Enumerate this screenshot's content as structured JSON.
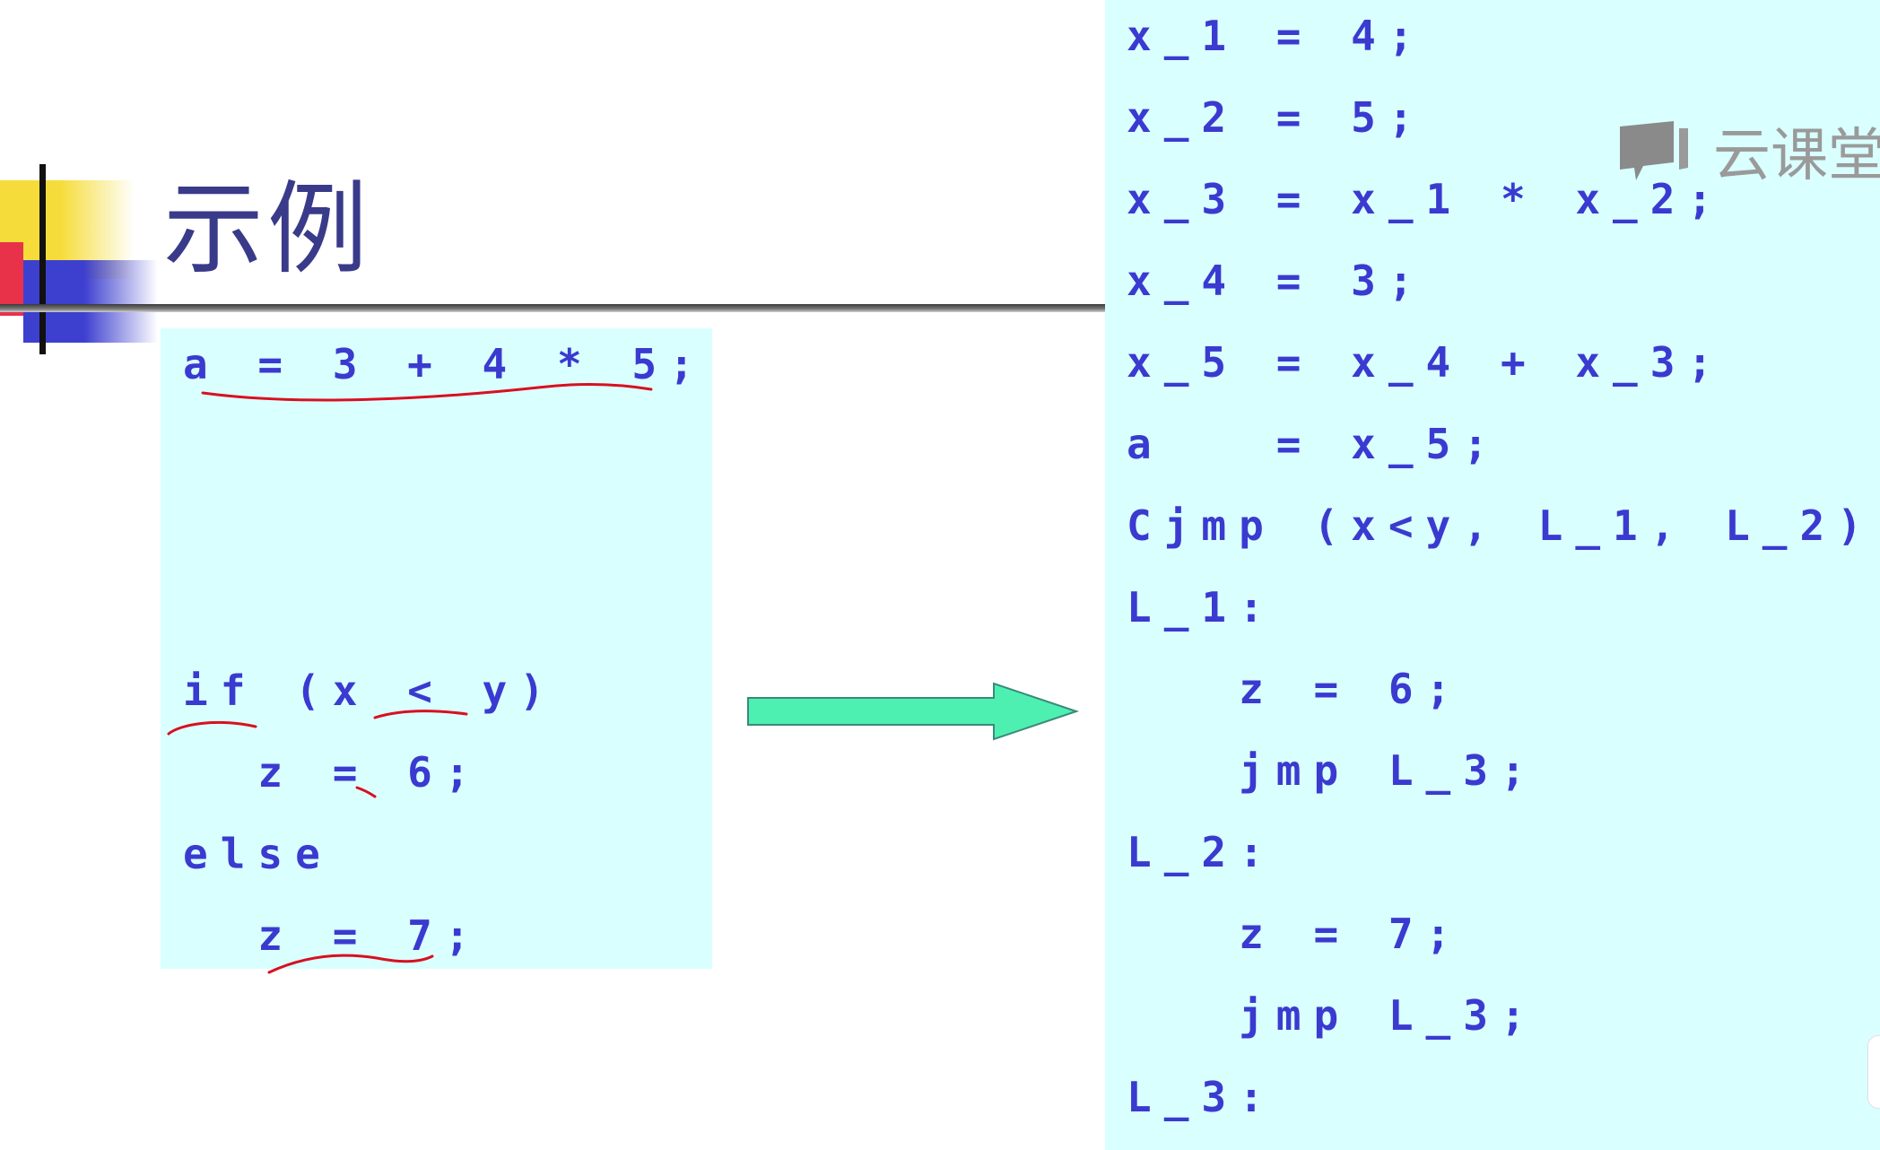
{
  "slide": {
    "title": "示例",
    "source_code": [
      "a = 3 + 4 * 5;",
      "if (x < y)",
      "  z = 6;",
      "else",
      "  z = 7;"
    ],
    "target_code": [
      "x_1 = 4;",
      "x_2 = 5;",
      "x_3 = x_1 * x_2;",
      "x_4 = 3;",
      "x_5 = x_4 + x_3;",
      "a   = x_5;",
      "Cjmp (x<y, L_1, L_2);",
      "L_1:",
      "   z = 6;",
      "   jmp L_3;",
      "L_2:",
      "   z = 7;",
      "   jmp L_3;",
      "L_3:"
    ]
  },
  "watermark": {
    "text": "云课堂",
    "icon": "chat-bubble-icon"
  },
  "colors": {
    "code_background": "#d9ffff",
    "code_text": "#3a3ad0",
    "title_text": "#3a3a8a",
    "arrow_fill": "#4df0b0",
    "ink_annotation": "#d81020"
  }
}
